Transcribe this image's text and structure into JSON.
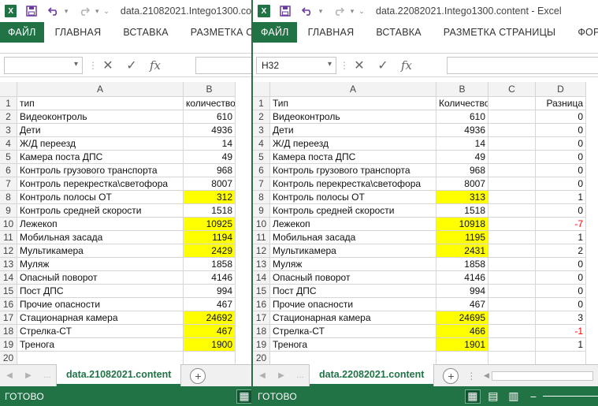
{
  "ribbon_tabs": [
    "ФАЙЛ",
    "ГЛАВНАЯ",
    "ВСТАВКА",
    "РАЗМЕТКА СТРАНИЦЫ",
    "ФОРМУЛЫ"
  ],
  "status": "ГОТОВО",
  "icons": {
    "logo": "excel-logo-icon",
    "save": "save-icon",
    "undo": "undo-icon",
    "redo": "redo-icon",
    "cancel": "cancel-formula-icon",
    "enter": "enter-formula-icon",
    "fx": "insert-function-icon"
  },
  "colors": {
    "accent": "#217346",
    "highlight": "#ffff00",
    "negative": "#ff0000"
  },
  "left": {
    "title": "data.21082021.Intego1300.co",
    "name_box": "",
    "sheet_tab": "data.21082021.content",
    "ribbon_visible": [
      "ФАЙЛ",
      "ГЛАВНАЯ",
      "ВСТАВКА",
      "РАЗМЕТКА СТРАНИ"
    ],
    "col_headers": [
      "A",
      "B"
    ],
    "rows": [
      [
        "тип",
        "количество"
      ],
      [
        "Видеоконтроль",
        "610"
      ],
      [
        "Дети",
        "4936"
      ],
      [
        "Ж/Д переезд",
        "14"
      ],
      [
        "Камера поста ДПС",
        "49"
      ],
      [
        "Контроль грузового транспорта",
        "968"
      ],
      [
        "Контроль перекрестка\\светофора",
        "8007"
      ],
      [
        "Контроль полосы ОТ",
        "312"
      ],
      [
        "Контроль средней скорости",
        "1518"
      ],
      [
        "Лежекоп",
        "10925"
      ],
      [
        "Мобильная засада",
        "1194"
      ],
      [
        "Мультикамера",
        "2429"
      ],
      [
        "Муляж",
        "1858"
      ],
      [
        "Опасный поворот",
        "4146"
      ],
      [
        "Пост ДПС",
        "994"
      ],
      [
        "Прочие опасности",
        "467"
      ],
      [
        "Стационарная камера",
        "24692"
      ],
      [
        "Стрелка-СТ",
        "467"
      ],
      [
        "Тренога",
        "1900"
      ],
      [
        "",
        ""
      ]
    ],
    "highlighted_rows": [
      8,
      10,
      11,
      12,
      17,
      18,
      19
    ]
  },
  "right": {
    "title": "data.22082021.Intego1300.content - Excel",
    "name_box": "H32",
    "sheet_tab": "data.22082021.content",
    "ribbon_visible": [
      "ФАЙЛ",
      "ГЛАВНАЯ",
      "ВСТАВКА",
      "РАЗМЕТКА СТРАНИЦЫ",
      "ФОРМУ"
    ],
    "col_headers": [
      "A",
      "B",
      "C",
      "D"
    ],
    "rows": [
      [
        "Тип",
        "Количество",
        "",
        "Разница"
      ],
      [
        "Видеоконтроль",
        "610",
        "",
        "0"
      ],
      [
        "Дети",
        "4936",
        "",
        "0"
      ],
      [
        "Ж/Д переезд",
        "14",
        "",
        "0"
      ],
      [
        "Камера поста ДПС",
        "49",
        "",
        "0"
      ],
      [
        "Контроль грузового транспорта",
        "968",
        "",
        "0"
      ],
      [
        "Контроль перекрестка\\светофора",
        "8007",
        "",
        "0"
      ],
      [
        "Контроль полосы ОТ",
        "313",
        "",
        "1"
      ],
      [
        "Контроль средней скорости",
        "1518",
        "",
        "0"
      ],
      [
        "Лежекоп",
        "10918",
        "",
        "-7"
      ],
      [
        "Мобильная засада",
        "1195",
        "",
        "1"
      ],
      [
        "Мультикамера",
        "2431",
        "",
        "2"
      ],
      [
        "Муляж",
        "1858",
        "",
        "0"
      ],
      [
        "Опасный поворот",
        "4146",
        "",
        "0"
      ],
      [
        "Пост ДПС",
        "994",
        "",
        "0"
      ],
      [
        "Прочие опасности",
        "467",
        "",
        "0"
      ],
      [
        "Стационарная камера",
        "24695",
        "",
        "3"
      ],
      [
        "Стрелка-СТ",
        "466",
        "",
        "-1"
      ],
      [
        "Тренога",
        "1901",
        "",
        "1"
      ],
      [
        "",
        "",
        "",
        ""
      ]
    ],
    "highlighted_rows": [
      8,
      10,
      11,
      12,
      17,
      18,
      19
    ]
  }
}
